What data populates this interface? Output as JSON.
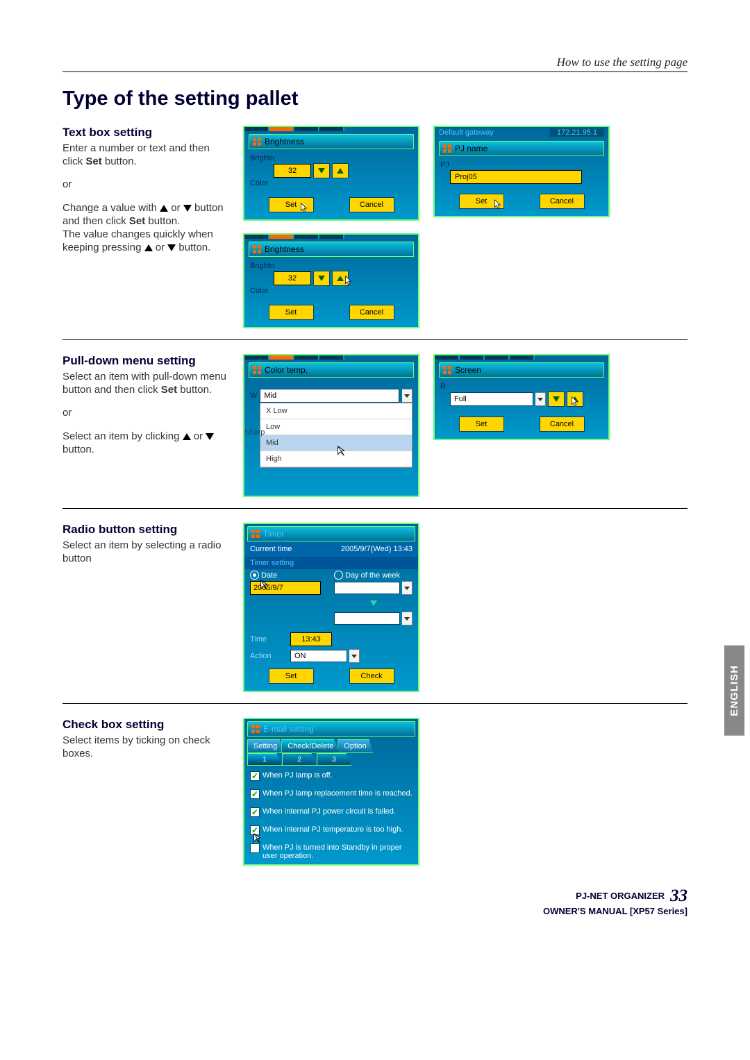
{
  "chapter": "How to use the setting page",
  "title": "Type of the setting pallet",
  "sec_textbox": {
    "heading": "Text box setting",
    "p1a": "Enter a number or text and then click ",
    "p1b": "Set",
    "p1c": " button.",
    "or": "or",
    "p2a": "Change a value with ",
    "p2b": " or ",
    "p2c": " button and then click ",
    "p2d": "Set",
    "p2e": " button.",
    "p3a": "The value changes quickly when keeping pressing ",
    "p3b": " or ",
    "p3c": " button."
  },
  "sec_pulldown": {
    "heading": "Pull-down menu setting",
    "p1a": "Select an item with pull-down menu button and then click ",
    "p1b": "Set",
    "p1c": " button.",
    "or": "or",
    "p2a": "Select an item by clicking ",
    "p2b": " or ",
    "p2c": " button."
  },
  "sec_radio": {
    "heading": "Radio button setting",
    "p1": "Select an item by selecting a radio button"
  },
  "sec_check": {
    "heading": "Check box setting",
    "p1": "Select items by ticking on check boxes."
  },
  "panel_brightness": {
    "label": "Brightness",
    "value": "32",
    "side1": "Brightn",
    "side2": "Color",
    "set": "Set",
    "cancel": "Cancel"
  },
  "panel_pjname": {
    "deflabel": "Default gateway",
    "ip": "172.21.95.1",
    "label": "PJ name",
    "value": "Proj05",
    "set": "Set",
    "cancel": "Cancel"
  },
  "panel_colortemp": {
    "label": "Color temp.",
    "side": "W",
    "side2": "Sharp",
    "selected": "Mid",
    "options": [
      "X Low",
      "Low",
      "Mid",
      "High"
    ]
  },
  "panel_screen": {
    "label": "Screen",
    "selected": "Full",
    "set": "Set",
    "cancel": "Cancel"
  },
  "panel_timer": {
    "label": "Timer",
    "row_current": "Current time",
    "row_current_val": "2005/9/7(Wed) 13:43",
    "row_setting": "Timer setting",
    "opt_date": "Date",
    "opt_dow": "Day of the week",
    "date_val": "2005/9/7",
    "time_lbl": "Time",
    "time_val": "13:43",
    "action_lbl": "Action",
    "action_val": "ON",
    "set": "Set",
    "check": "Check"
  },
  "panel_email": {
    "label": "E-mail setting",
    "tabs": [
      "Setting",
      "Check/Delete",
      "Option"
    ],
    "subtabs": [
      "1",
      "2",
      "3"
    ],
    "items": [
      "When PJ lamp is off.",
      "When PJ lamp replacement time is reached.",
      "When internal PJ power circuit is failed.",
      "When internal PJ temperature is too high.",
      "When PJ is turned into Standby in proper user operation."
    ]
  },
  "lang": "ENGLISH",
  "footer1": "PJ-NET ORGANIZER",
  "footer2": "OWNER'S MANUAL [XP57 Series]",
  "pagenum": "33"
}
